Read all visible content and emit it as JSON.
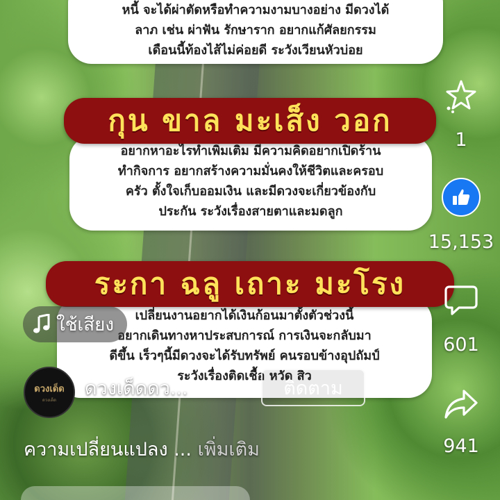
{
  "cards": [
    {
      "lines": [
        "หนี้ จะได้ผ่าตัดหรือทำความงามบางอย่าง มีดวงได้",
        "ลาภ เช่น ผ่าฟัน รักษาราก อยากแก้ศัลยกรรม",
        "เดือนนี้ท้องไส้ไม่ค่อยดี ระวังเวียนหัวบ่อย"
      ]
    },
    {
      "banner": "กุน ขาล มะเส็ง วอก",
      "lines": [
        "อยากหาอะไรทำเพิ่มเติม มีความคิดอยากเปิดร้าน",
        "ทำกิจการ อยากสร้างความมั่นคงให้ชีวิตและครอบ",
        "ครัว ตั้งใจเก็บออมเงิน และมีดวงจะเกี่ยวข้องกับ",
        "ประกัน ระวังเรื่องสายตาและมดลูก"
      ]
    },
    {
      "banner": "ระกา ฉลู เถาะ มะโรง",
      "lines": [
        "เปลี่ยนงานอยากได้เงินก้อนมาตั้งตัวช่วงนี้",
        "อยากเดินทางหาประสบการณ์ การเงินจะกลับมา",
        "ดีขึ้น เร็วๆนี้มีดวงจะได้รับทรัพย์ คนรอบข้างอุปถัมป์",
        "ระวังเรื่องติดเชื้อ หวัด สิว"
      ]
    }
  ],
  "actions": {
    "favorite": {
      "icon": "sparkle-star-icon",
      "count": "1"
    },
    "like": {
      "icon": "thumbs-up-icon",
      "count": "15,153"
    },
    "comment": {
      "icon": "comment-bubble-icon",
      "count": "601"
    },
    "share": {
      "icon": "share-arrow-icon",
      "count": "941"
    }
  },
  "music": {
    "icon": "music-note-icon",
    "label": "ใช้เสียง"
  },
  "author": {
    "avatar_text": "ดวงเด็ด",
    "avatar_sub": "ดวงเด็ด",
    "name": "ดวงเด็ดดว...",
    "follow_label": "ติดตาม"
  },
  "caption": {
    "text": "ความเปลี่ยนแปลง ...",
    "more": "เพิ่มเติม"
  },
  "colors": {
    "banner": "#8e0f0f",
    "banner_text": "#ffe25a",
    "like_blue": "#1877f2"
  }
}
